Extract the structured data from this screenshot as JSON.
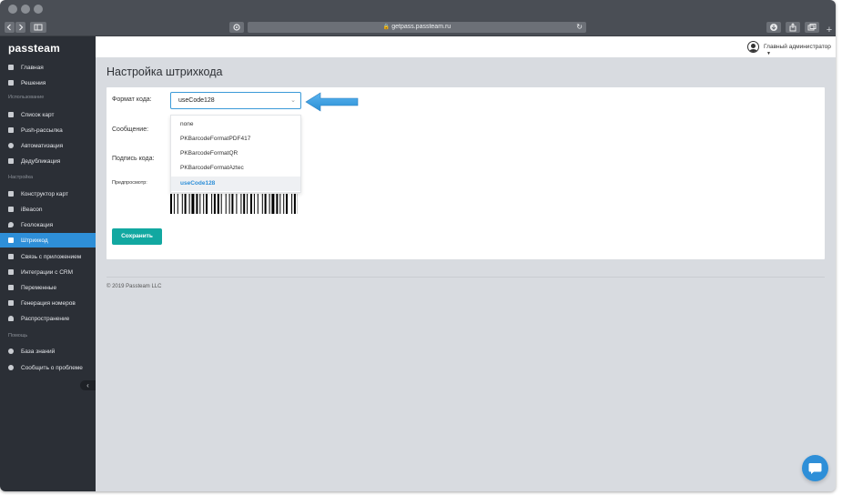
{
  "browser": {
    "url": "getpass.passteam.ru",
    "new_tab": "+"
  },
  "sidebar": {
    "brand": "passteam",
    "sections": {
      "usage": "Использование",
      "settings": "Настройка",
      "help": "Помощь"
    },
    "items": [
      {
        "label": "Главная",
        "icon": "home-icon"
      },
      {
        "label": "Решения",
        "icon": "solutions-icon"
      },
      {
        "label": "Список карт",
        "icon": "list-icon"
      },
      {
        "label": "Push-рассылка",
        "icon": "megaphone-icon"
      },
      {
        "label": "Автоматизация",
        "icon": "automation-icon"
      },
      {
        "label": "Дедубликация",
        "icon": "duplicate-icon"
      },
      {
        "label": "Конструктор карт",
        "icon": "brush-icon"
      },
      {
        "label": "iBeacon",
        "icon": "beacon-icon"
      },
      {
        "label": "Геолокация",
        "icon": "location-pin-icon"
      },
      {
        "label": "Штрихкод",
        "icon": "barcode-icon",
        "active": true
      },
      {
        "label": "Связь с приложением",
        "icon": "link-icon"
      },
      {
        "label": "Интеграции с CRM",
        "icon": "integration-icon"
      },
      {
        "label": "Переменные",
        "icon": "variables-icon"
      },
      {
        "label": "Генерация номеров",
        "icon": "grid-icon"
      },
      {
        "label": "Распространение",
        "icon": "bell-icon"
      },
      {
        "label": "База знаний",
        "icon": "lifebuoy-icon"
      },
      {
        "label": "Сообщить о проблеме",
        "icon": "bug-icon"
      }
    ],
    "collapse_icon": "chevron-left-icon"
  },
  "header": {
    "user_name": "Главный администратор"
  },
  "main": {
    "title": "Настройка штрихкода",
    "form": {
      "format_label": "Формат кода:",
      "format_value": "useCode128",
      "message_label": "Сообщение:",
      "caption_label": "Подпись кода:",
      "preview_label": "Предпросмотр:",
      "options": [
        "none",
        "PKBarcodeFormatPDF417",
        "PKBarcodeFormatQR",
        "PKBarcodeFormatAztec",
        "useCode128"
      ],
      "selected_option": "useCode128",
      "save_label": "Сохранить"
    },
    "footer": "© 2019 Passteam LLC"
  },
  "colors": {
    "sidebar_bg": "#2b2f36",
    "accent": "#2e8fd8",
    "save_button": "#12a8a1",
    "content_bg": "#d8dbe0"
  }
}
